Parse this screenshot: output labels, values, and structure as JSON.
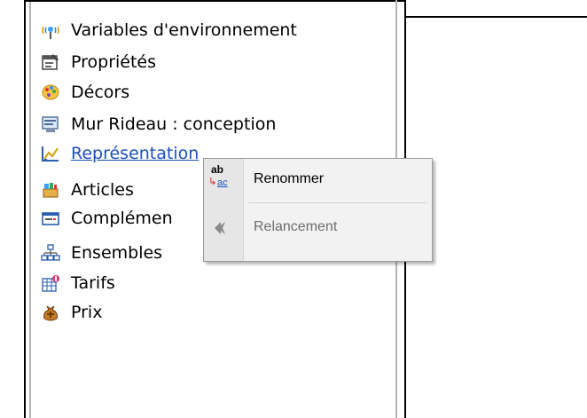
{
  "tree": {
    "items": [
      {
        "label": "Variables d'environnement",
        "icon": "antenna-icon"
      },
      {
        "label": "Propriétés",
        "icon": "properties-icon"
      },
      {
        "label": "Décors",
        "icon": "palette-icon"
      },
      {
        "label": "Mur Rideau : conception",
        "icon": "design-icon"
      },
      {
        "label": "Représentation",
        "icon": "drawing-icon",
        "state": "selected-link"
      },
      {
        "label": "Articles",
        "icon": "articles-icon"
      },
      {
        "label": "Complémen",
        "icon": "complement-icon"
      },
      {
        "label": "Ensembles",
        "icon": "hierarchy-icon"
      },
      {
        "label": "Tarifs",
        "icon": "tariff-icon"
      },
      {
        "label": "Prix",
        "icon": "money-bag-icon"
      }
    ]
  },
  "context_menu": {
    "items": [
      {
        "label": "Renommer",
        "icon": "rename-icon",
        "icon_text_top": "ab",
        "icon_text_bottom": "ac",
        "enabled": true
      },
      {
        "label": "Relancement",
        "icon": "relaunch-icon",
        "enabled": false
      }
    ]
  },
  "colors": {
    "link": "#1a4fbf",
    "disabled_text": "#6d6d6d",
    "menu_background": "#f2f2f2"
  }
}
